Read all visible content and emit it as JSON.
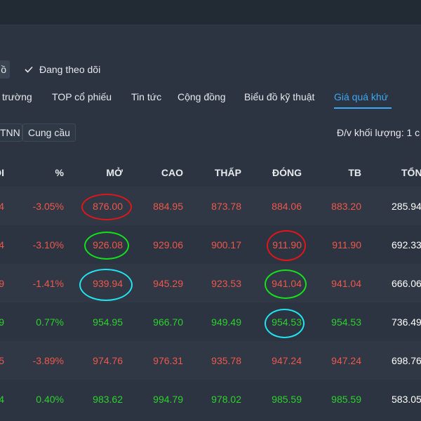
{
  "colors": {
    "up": "#2fd12f",
    "down": "#f0574c",
    "accent": "#3ea8f5"
  },
  "toolbar": {
    "left_chip_label": "ồ",
    "follow_label": "Đang theo dõi"
  },
  "tabs": [
    {
      "label": "ị trường"
    },
    {
      "label": "TOP cổ phiếu"
    },
    {
      "label": "Tin tức"
    },
    {
      "label": "Cộng đồng"
    },
    {
      "label": "Biểu đồ kỹ thuật"
    },
    {
      "label": "Giá quá khứ",
      "active": true
    }
  ],
  "filters": {
    "btn_nn": "TNN",
    "btn_cung_cau": "Cung cầu",
    "unit_label": "Đ/v khối lượng: 1 c"
  },
  "table": {
    "headers": {
      "first": "ỔI",
      "pct": "%",
      "mo": "MỞ",
      "cao": "CAO",
      "thap": "THẤP",
      "dong": "ĐÓNG",
      "tb": "TB",
      "ton": "TỔN"
    },
    "rows": [
      {
        "first": "4",
        "pct": "-3.05%",
        "mo": "876.00",
        "cao": "884.95",
        "thap": "873.78",
        "dong": "884.06",
        "tb": "883.20",
        "ton": "285.94",
        "trend": "down"
      },
      {
        "first": "4",
        "pct": "-3.10%",
        "mo": "926.08",
        "cao": "929.06",
        "thap": "900.17",
        "dong": "911.90",
        "tb": "911.90",
        "ton": "692.33",
        "trend": "down"
      },
      {
        "first": "9",
        "pct": "-1.41%",
        "mo": "939.94",
        "cao": "945.29",
        "thap": "923.53",
        "dong": "941.04",
        "tb": "941.04",
        "ton": "666.06",
        "trend": "down"
      },
      {
        "first": "9",
        "pct": "0.77%",
        "mo": "954.95",
        "cao": "966.70",
        "thap": "949.49",
        "dong": "954.53",
        "tb": "954.53",
        "ton": "736.49",
        "trend": "up"
      },
      {
        "first": "5",
        "pct": "-3.89%",
        "mo": "974.76",
        "cao": "976.31",
        "thap": "935.78",
        "dong": "947.24",
        "tb": "947.24",
        "ton": "698.76",
        "trend": "down"
      },
      {
        "first": "4",
        "pct": "0.40%",
        "mo": "983.62",
        "cao": "994.79",
        "thap": "978.02",
        "dong": "985.59",
        "tb": "985.59",
        "ton": "583.05",
        "trend": "up"
      }
    ]
  }
}
